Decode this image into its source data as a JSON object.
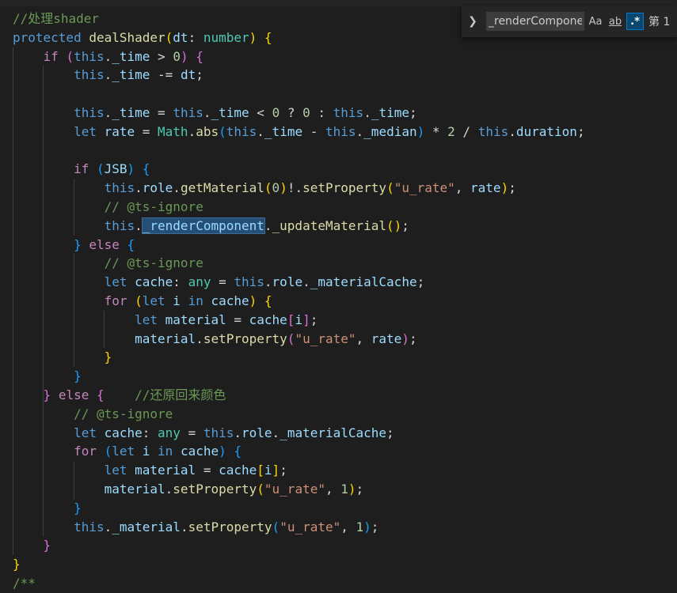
{
  "find": {
    "query": "_renderComponent",
    "match_case_label": "Aa",
    "whole_word_label": "ab",
    "regex_label": ".*",
    "result_label": "第 1"
  },
  "code": {
    "lines": [
      [
        {
          "c": "t-comment",
          "t": "//处理shader"
        }
      ],
      [
        {
          "c": "t-kw",
          "t": "protected "
        },
        {
          "c": "t-fn",
          "t": "dealShader"
        },
        {
          "c": "t-br1",
          "t": "("
        },
        {
          "c": "t-var",
          "t": "dt"
        },
        {
          "c": "t-op",
          "t": ": "
        },
        {
          "c": "t-type",
          "t": "number"
        },
        {
          "c": "t-br1",
          "t": ")"
        },
        {
          "c": "t-op",
          "t": " "
        },
        {
          "c": "t-br1",
          "t": "{"
        }
      ],
      [
        {
          "c": "t-op",
          "t": "    "
        },
        {
          "c": "t-ctrl",
          "t": "if "
        },
        {
          "c": "t-br2",
          "t": "("
        },
        {
          "c": "t-kw",
          "t": "this"
        },
        {
          "c": "t-op",
          "t": "."
        },
        {
          "c": "t-var",
          "t": "_time"
        },
        {
          "c": "t-op",
          "t": " > "
        },
        {
          "c": "t-num",
          "t": "0"
        },
        {
          "c": "t-br2",
          "t": ")"
        },
        {
          "c": "t-op",
          "t": " "
        },
        {
          "c": "t-br2",
          "t": "{"
        }
      ],
      [
        {
          "c": "t-op",
          "t": "        "
        },
        {
          "c": "t-kw",
          "t": "this"
        },
        {
          "c": "t-op",
          "t": "."
        },
        {
          "c": "t-var",
          "t": "_time"
        },
        {
          "c": "t-op",
          "t": " -= "
        },
        {
          "c": "t-var",
          "t": "dt"
        },
        {
          "c": "t-op",
          "t": ";"
        }
      ],
      [],
      [
        {
          "c": "t-op",
          "t": "        "
        },
        {
          "c": "t-kw",
          "t": "this"
        },
        {
          "c": "t-op",
          "t": "."
        },
        {
          "c": "t-var",
          "t": "_time"
        },
        {
          "c": "t-op",
          "t": " = "
        },
        {
          "c": "t-kw",
          "t": "this"
        },
        {
          "c": "t-op",
          "t": "."
        },
        {
          "c": "t-var",
          "t": "_time"
        },
        {
          "c": "t-op",
          "t": " < "
        },
        {
          "c": "t-num",
          "t": "0"
        },
        {
          "c": "t-op",
          "t": " ? "
        },
        {
          "c": "t-num",
          "t": "0"
        },
        {
          "c": "t-op",
          "t": " : "
        },
        {
          "c": "t-kw",
          "t": "this"
        },
        {
          "c": "t-op",
          "t": "."
        },
        {
          "c": "t-var",
          "t": "_time"
        },
        {
          "c": "t-op",
          "t": ";"
        }
      ],
      [
        {
          "c": "t-op",
          "t": "        "
        },
        {
          "c": "t-kw",
          "t": "let "
        },
        {
          "c": "t-var",
          "t": "rate"
        },
        {
          "c": "t-op",
          "t": " = "
        },
        {
          "c": "t-type",
          "t": "Math"
        },
        {
          "c": "t-op",
          "t": "."
        },
        {
          "c": "t-fn",
          "t": "abs"
        },
        {
          "c": "t-br3",
          "t": "("
        },
        {
          "c": "t-kw",
          "t": "this"
        },
        {
          "c": "t-op",
          "t": "."
        },
        {
          "c": "t-var",
          "t": "_time"
        },
        {
          "c": "t-op",
          "t": " - "
        },
        {
          "c": "t-kw",
          "t": "this"
        },
        {
          "c": "t-op",
          "t": "."
        },
        {
          "c": "t-var",
          "t": "_median"
        },
        {
          "c": "t-br3",
          "t": ")"
        },
        {
          "c": "t-op",
          "t": " * "
        },
        {
          "c": "t-num",
          "t": "2"
        },
        {
          "c": "t-op",
          "t": " / "
        },
        {
          "c": "t-kw",
          "t": "this"
        },
        {
          "c": "t-op",
          "t": "."
        },
        {
          "c": "t-var",
          "t": "duration"
        },
        {
          "c": "t-op",
          "t": ";"
        }
      ],
      [],
      [
        {
          "c": "t-op",
          "t": "        "
        },
        {
          "c": "t-ctrl",
          "t": "if "
        },
        {
          "c": "t-br3",
          "t": "("
        },
        {
          "c": "t-var",
          "t": "JSB"
        },
        {
          "c": "t-br3",
          "t": ")"
        },
        {
          "c": "t-op",
          "t": " "
        },
        {
          "c": "t-br3",
          "t": "{"
        }
      ],
      [
        {
          "c": "t-op",
          "t": "            "
        },
        {
          "c": "t-kw",
          "t": "this"
        },
        {
          "c": "t-op",
          "t": "."
        },
        {
          "c": "t-var",
          "t": "role"
        },
        {
          "c": "t-op",
          "t": "."
        },
        {
          "c": "t-fn",
          "t": "getMaterial"
        },
        {
          "c": "t-br1",
          "t": "("
        },
        {
          "c": "t-num",
          "t": "0"
        },
        {
          "c": "t-br1",
          "t": ")"
        },
        {
          "c": "t-op",
          "t": "!."
        },
        {
          "c": "t-fn",
          "t": "setProperty"
        },
        {
          "c": "t-br1",
          "t": "("
        },
        {
          "c": "t-str",
          "t": "\"u_rate\""
        },
        {
          "c": "t-op",
          "t": ", "
        },
        {
          "c": "t-var",
          "t": "rate"
        },
        {
          "c": "t-br1",
          "t": ")"
        },
        {
          "c": "t-op",
          "t": ";"
        }
      ],
      [
        {
          "c": "t-op",
          "t": "            "
        },
        {
          "c": "t-comment",
          "t": "// @ts-ignore"
        }
      ],
      [
        {
          "c": "t-op",
          "t": "            "
        },
        {
          "c": "t-kw",
          "t": "this"
        },
        {
          "c": "t-op",
          "t": "."
        },
        {
          "c": "t-var t-hl",
          "t": "_renderComponent"
        },
        {
          "c": "t-op",
          "t": "."
        },
        {
          "c": "t-fn",
          "t": "_updateMaterial"
        },
        {
          "c": "t-br1",
          "t": "()"
        },
        {
          "c": "t-op",
          "t": ";"
        }
      ],
      [
        {
          "c": "t-op",
          "t": "        "
        },
        {
          "c": "t-br3",
          "t": "}"
        },
        {
          "c": "t-op",
          "t": " "
        },
        {
          "c": "t-ctrl",
          "t": "else "
        },
        {
          "c": "t-br3",
          "t": "{"
        }
      ],
      [
        {
          "c": "t-op",
          "t": "            "
        },
        {
          "c": "t-comment",
          "t": "// @ts-ignore"
        }
      ],
      [
        {
          "c": "t-op",
          "t": "            "
        },
        {
          "c": "t-kw",
          "t": "let "
        },
        {
          "c": "t-var",
          "t": "cache"
        },
        {
          "c": "t-op",
          "t": ": "
        },
        {
          "c": "t-type",
          "t": "any"
        },
        {
          "c": "t-op",
          "t": " = "
        },
        {
          "c": "t-kw",
          "t": "this"
        },
        {
          "c": "t-op",
          "t": "."
        },
        {
          "c": "t-var",
          "t": "role"
        },
        {
          "c": "t-op",
          "t": "."
        },
        {
          "c": "t-var",
          "t": "_materialCache"
        },
        {
          "c": "t-op",
          "t": ";"
        }
      ],
      [
        {
          "c": "t-op",
          "t": "            "
        },
        {
          "c": "t-ctrl",
          "t": "for "
        },
        {
          "c": "t-br1",
          "t": "("
        },
        {
          "c": "t-kw",
          "t": "let "
        },
        {
          "c": "t-var",
          "t": "i"
        },
        {
          "c": "t-kw",
          "t": " in "
        },
        {
          "c": "t-var",
          "t": "cache"
        },
        {
          "c": "t-br1",
          "t": ")"
        },
        {
          "c": "t-op",
          "t": " "
        },
        {
          "c": "t-br1",
          "t": "{"
        }
      ],
      [
        {
          "c": "t-op",
          "t": "                "
        },
        {
          "c": "t-kw",
          "t": "let "
        },
        {
          "c": "t-var",
          "t": "material"
        },
        {
          "c": "t-op",
          "t": " = "
        },
        {
          "c": "t-var",
          "t": "cache"
        },
        {
          "c": "t-br2",
          "t": "["
        },
        {
          "c": "t-var",
          "t": "i"
        },
        {
          "c": "t-br2",
          "t": "]"
        },
        {
          "c": "t-op",
          "t": ";"
        }
      ],
      [
        {
          "c": "t-op",
          "t": "                "
        },
        {
          "c": "t-var",
          "t": "material"
        },
        {
          "c": "t-op",
          "t": "."
        },
        {
          "c": "t-fn",
          "t": "setProperty"
        },
        {
          "c": "t-br2",
          "t": "("
        },
        {
          "c": "t-str",
          "t": "\"u_rate\""
        },
        {
          "c": "t-op",
          "t": ", "
        },
        {
          "c": "t-var",
          "t": "rate"
        },
        {
          "c": "t-br2",
          "t": ")"
        },
        {
          "c": "t-op",
          "t": ";"
        }
      ],
      [
        {
          "c": "t-op",
          "t": "            "
        },
        {
          "c": "t-br1",
          "t": "}"
        }
      ],
      [
        {
          "c": "t-op",
          "t": "        "
        },
        {
          "c": "t-br3",
          "t": "}"
        }
      ],
      [
        {
          "c": "t-op",
          "t": "    "
        },
        {
          "c": "t-br2",
          "t": "}"
        },
        {
          "c": "t-op",
          "t": " "
        },
        {
          "c": "t-ctrl",
          "t": "else "
        },
        {
          "c": "t-br2",
          "t": "{"
        },
        {
          "c": "t-op",
          "t": "    "
        },
        {
          "c": "t-comment",
          "t": "//还原回来颜色"
        }
      ],
      [
        {
          "c": "t-op",
          "t": "        "
        },
        {
          "c": "t-comment",
          "t": "// @ts-ignore"
        }
      ],
      [
        {
          "c": "t-op",
          "t": "        "
        },
        {
          "c": "t-kw",
          "t": "let "
        },
        {
          "c": "t-var",
          "t": "cache"
        },
        {
          "c": "t-op",
          "t": ": "
        },
        {
          "c": "t-type",
          "t": "any"
        },
        {
          "c": "t-op",
          "t": " = "
        },
        {
          "c": "t-kw",
          "t": "this"
        },
        {
          "c": "t-op",
          "t": "."
        },
        {
          "c": "t-var",
          "t": "role"
        },
        {
          "c": "t-op",
          "t": "."
        },
        {
          "c": "t-var",
          "t": "_materialCache"
        },
        {
          "c": "t-op",
          "t": ";"
        }
      ],
      [
        {
          "c": "t-op",
          "t": "        "
        },
        {
          "c": "t-ctrl",
          "t": "for "
        },
        {
          "c": "t-br3",
          "t": "("
        },
        {
          "c": "t-kw",
          "t": "let "
        },
        {
          "c": "t-var",
          "t": "i"
        },
        {
          "c": "t-kw",
          "t": " in "
        },
        {
          "c": "t-var",
          "t": "cache"
        },
        {
          "c": "t-br3",
          "t": ")"
        },
        {
          "c": "t-op",
          "t": " "
        },
        {
          "c": "t-br3",
          "t": "{"
        }
      ],
      [
        {
          "c": "t-op",
          "t": "            "
        },
        {
          "c": "t-kw",
          "t": "let "
        },
        {
          "c": "t-var",
          "t": "material"
        },
        {
          "c": "t-op",
          "t": " = "
        },
        {
          "c": "t-var",
          "t": "cache"
        },
        {
          "c": "t-br1",
          "t": "["
        },
        {
          "c": "t-var",
          "t": "i"
        },
        {
          "c": "t-br1",
          "t": "]"
        },
        {
          "c": "t-op",
          "t": ";"
        }
      ],
      [
        {
          "c": "t-op",
          "t": "            "
        },
        {
          "c": "t-var",
          "t": "material"
        },
        {
          "c": "t-op",
          "t": "."
        },
        {
          "c": "t-fn",
          "t": "setProperty"
        },
        {
          "c": "t-br1",
          "t": "("
        },
        {
          "c": "t-str",
          "t": "\"u_rate\""
        },
        {
          "c": "t-op",
          "t": ", "
        },
        {
          "c": "t-num",
          "t": "1"
        },
        {
          "c": "t-br1",
          "t": ")"
        },
        {
          "c": "t-op",
          "t": ";"
        }
      ],
      [
        {
          "c": "t-op",
          "t": "        "
        },
        {
          "c": "t-br3",
          "t": "}"
        }
      ],
      [
        {
          "c": "t-op",
          "t": "        "
        },
        {
          "c": "t-kw",
          "t": "this"
        },
        {
          "c": "t-op",
          "t": "."
        },
        {
          "c": "t-var",
          "t": "_material"
        },
        {
          "c": "t-op",
          "t": "."
        },
        {
          "c": "t-fn",
          "t": "setProperty"
        },
        {
          "c": "t-br3",
          "t": "("
        },
        {
          "c": "t-str",
          "t": "\"u_rate\""
        },
        {
          "c": "t-op",
          "t": ", "
        },
        {
          "c": "t-num",
          "t": "1"
        },
        {
          "c": "t-br3",
          "t": ")"
        },
        {
          "c": "t-op",
          "t": ";"
        }
      ],
      [
        {
          "c": "t-op",
          "t": "    "
        },
        {
          "c": "t-br2",
          "t": "}"
        }
      ],
      [
        {
          "c": "t-br1",
          "t": "}"
        }
      ],
      [
        {
          "c": "t-comment",
          "t": "/**"
        }
      ]
    ]
  }
}
